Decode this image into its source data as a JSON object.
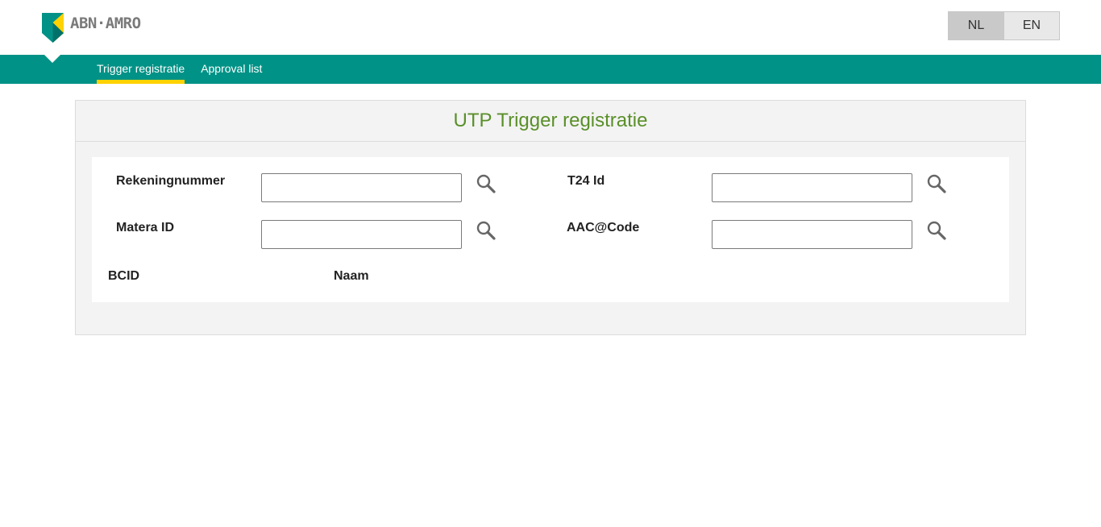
{
  "brand": {
    "name": "ABN·AMRO",
    "colors": {
      "teal": "#009286",
      "yellow": "#ffd200",
      "gray": "#7a7a7a"
    }
  },
  "language": {
    "options": [
      "NL",
      "EN"
    ],
    "selected": "NL"
  },
  "nav": {
    "tabs": [
      {
        "label": "Trigger registratie",
        "active": true
      },
      {
        "label": "Approval list",
        "active": false
      }
    ]
  },
  "panel": {
    "title": "UTP Trigger registratie",
    "title_color": "#5a8f29"
  },
  "form": {
    "rekeningnummer": {
      "label": "Rekeningnummer",
      "value": "",
      "icon": "search-icon"
    },
    "t24_id": {
      "label": "T24 Id",
      "value": "",
      "icon": "search-icon"
    },
    "matera_id": {
      "label": "Matera ID",
      "value": "",
      "icon": "search-icon"
    },
    "aac_code": {
      "label": "AAC@Code",
      "value": "",
      "icon": "search-icon"
    },
    "bcid": {
      "label": "BCID"
    },
    "naam": {
      "label": "Naam"
    }
  }
}
